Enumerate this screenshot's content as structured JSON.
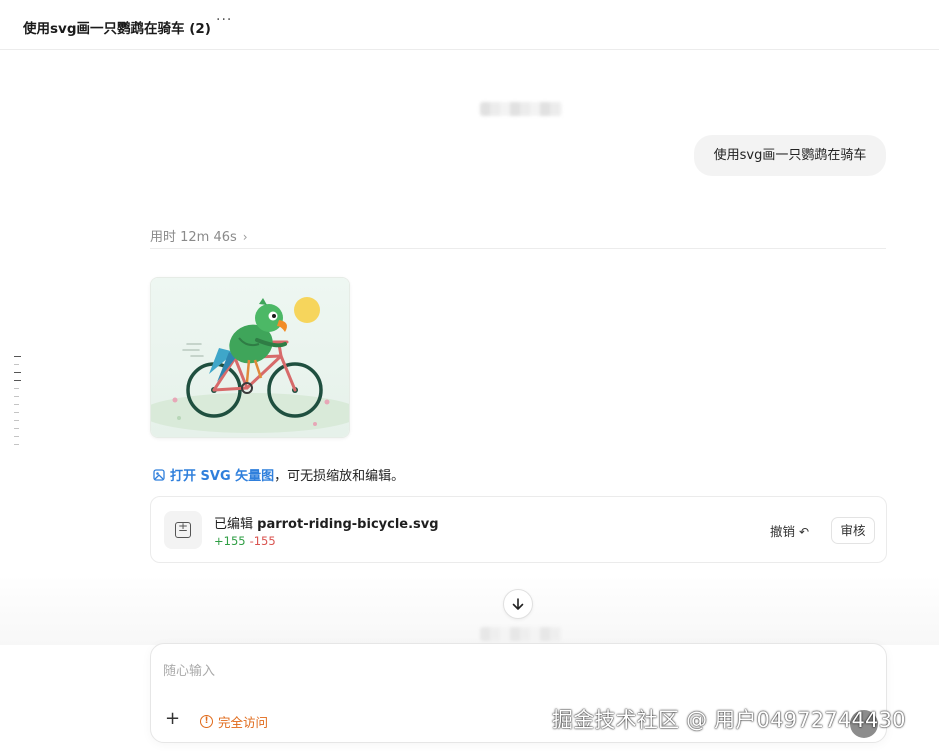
{
  "header": {
    "title": "使用svg画一只鹦鹉在骑车 (2)",
    "more_label": "···"
  },
  "conversation": {
    "user_message": "使用svg画一只鹦鹉在骑车",
    "thinking_label": "用时 12m 46s",
    "open_svg": {
      "link_label": "打开 SVG 矢量图",
      "rest": "，可无损缩放和编辑。"
    },
    "file_card": {
      "status": "已编辑",
      "filename": "parrot-riding-bicycle.svg",
      "additions": "+155",
      "deletions": "-155",
      "undo_label": "撤销",
      "review_label": "审核"
    }
  },
  "composer": {
    "placeholder": "随心输入",
    "access_label": "完全访问"
  },
  "watermark": "掘金技术社区 @ 用户04972744430",
  "icons": {
    "more": "ellipsis-icon",
    "chevron": "chevron-right-icon",
    "open_svg": "image-icon",
    "file": "diff-icon",
    "undo": "undo-icon",
    "scroll": "arrow-down-icon",
    "plus": "plus-icon",
    "warning": "warning-icon",
    "send": "send-icon"
  },
  "colors": {
    "link": "#2f7fdc",
    "additions": "#2f9e44",
    "deletions": "#d9534f",
    "access": "#e06a1a"
  }
}
